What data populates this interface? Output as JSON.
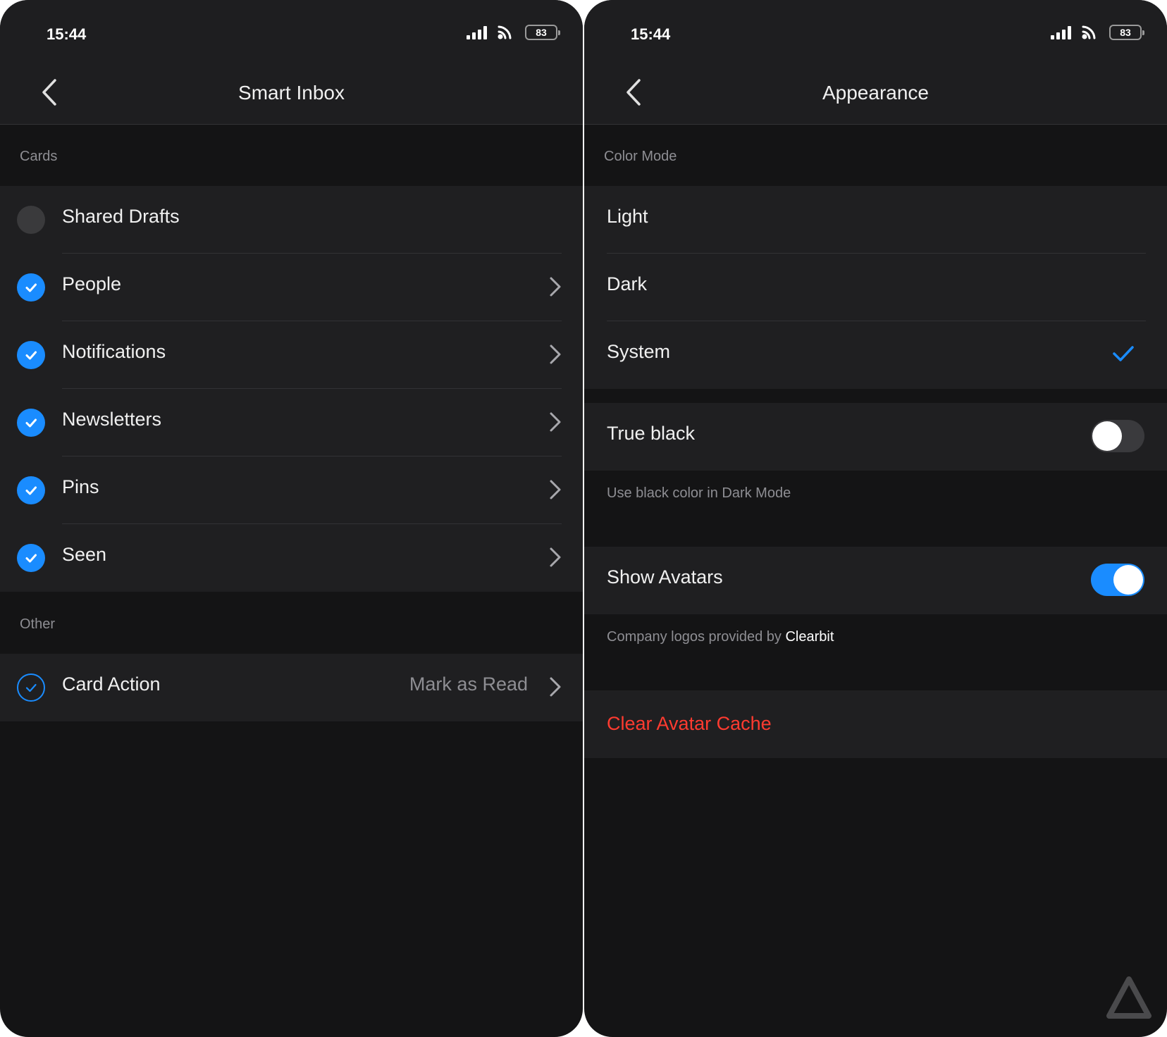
{
  "status_bar": {
    "time": "15:44",
    "battery": "83"
  },
  "left_screen": {
    "title": "Smart Inbox",
    "sections": {
      "cards_header": "Cards",
      "other_header": "Other"
    },
    "card_items": [
      {
        "label": "Shared Drafts",
        "checked": false,
        "has_chevron": false
      },
      {
        "label": "People",
        "checked": true,
        "has_chevron": true
      },
      {
        "label": "Notifications",
        "checked": true,
        "has_chevron": true
      },
      {
        "label": "Newsletters",
        "checked": true,
        "has_chevron": true
      },
      {
        "label": "Pins",
        "checked": true,
        "has_chevron": true
      },
      {
        "label": "Seen",
        "checked": true,
        "has_chevron": true
      }
    ],
    "card_action": {
      "label": "Card Action",
      "value": "Mark as Read"
    }
  },
  "right_screen": {
    "title": "Appearance",
    "color_mode_header": "Color Mode",
    "color_modes": [
      {
        "label": "Light",
        "selected": false
      },
      {
        "label": "Dark",
        "selected": false
      },
      {
        "label": "System",
        "selected": true
      }
    ],
    "true_black": {
      "label": "True black",
      "enabled": false,
      "footnote": "Use black color in Dark Mode"
    },
    "show_avatars": {
      "label": "Show Avatars",
      "enabled": true,
      "footnote_prefix": "Company logos provided by ",
      "footnote_link": "Clearbit"
    },
    "clear_cache_label": "Clear Avatar Cache"
  },
  "colors": {
    "accent": "#1a8cff",
    "danger": "#ff3b30",
    "background": "#141415",
    "group_background": "#1f1f21"
  },
  "icons": {
    "back": "chevron-left-icon",
    "row_chevron": "chevron-right-icon",
    "checked": "checkmark-circle-icon",
    "selected": "checkmark-icon",
    "signal": "cellular-signal-icon",
    "wifi": "wifi-icon",
    "battery": "battery-icon",
    "watermark": "triangle-logo-icon"
  }
}
